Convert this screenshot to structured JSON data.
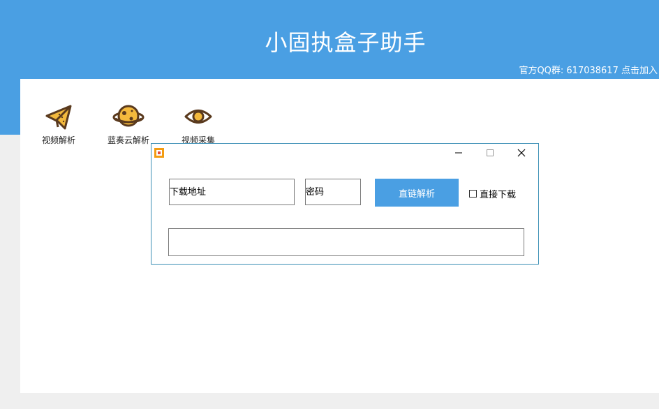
{
  "header": {
    "title": "小固执盒子助手",
    "qq_line": "官方QQ群: 617038617 点击加入"
  },
  "tools": [
    {
      "label": "视频解析",
      "icon": "paper-plane-icon"
    },
    {
      "label": "蓝奏云解析",
      "icon": "planet-icon"
    },
    {
      "label": "视频采集",
      "icon": "eye-icon"
    }
  ],
  "dialog": {
    "download_placeholder": "下载地址",
    "password_placeholder": "密码",
    "parse_button": "直链解析",
    "direct_download_label": "直接下载",
    "direct_download_checked": false
  },
  "colors": {
    "header": "#4a9fe3",
    "dialog_border": "#3b8fb5",
    "icon_outline": "#5a3a1e",
    "icon_fill": "#f3b93d"
  }
}
